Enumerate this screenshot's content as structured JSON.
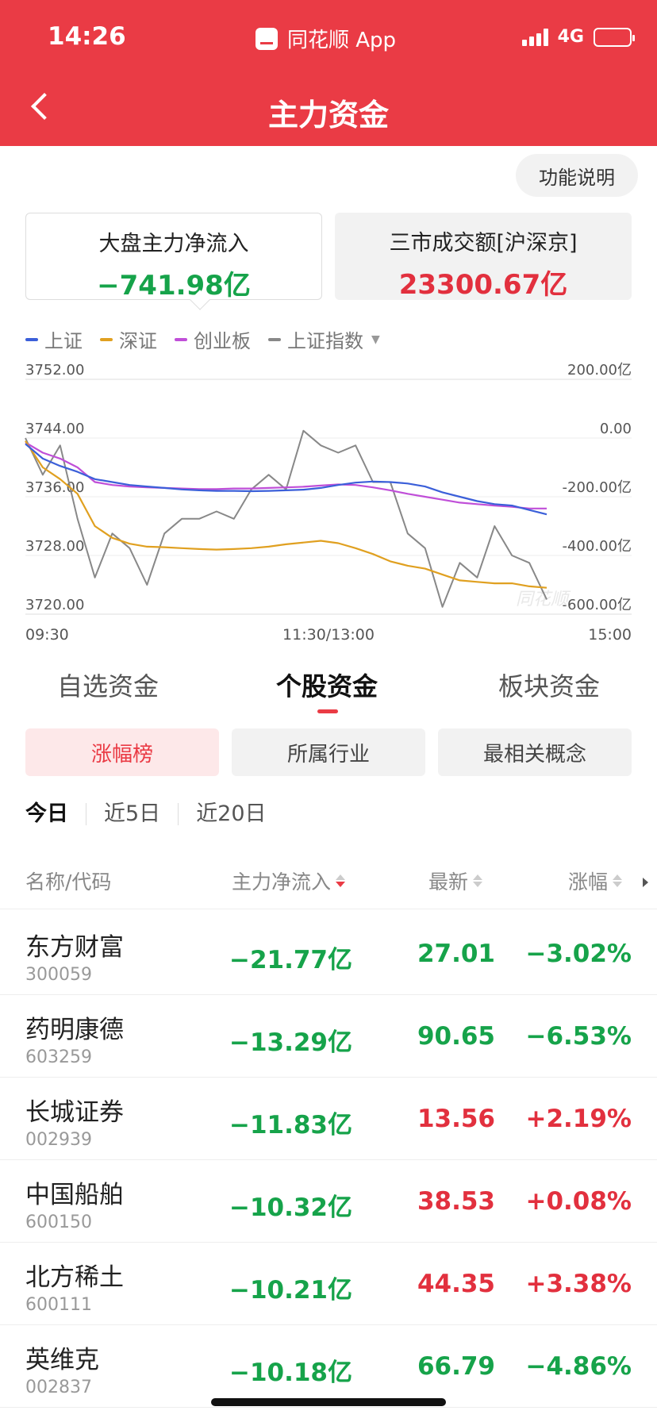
{
  "status": {
    "time": "14:26",
    "app_name": "同花顺 App",
    "network": "4G"
  },
  "header": {
    "title": "主力资金"
  },
  "func_button": "功能说明",
  "summary": {
    "left": {
      "title": "大盘主力净流入",
      "value": "−741.98亿"
    },
    "right": {
      "title": "三市成交额[沪深京]",
      "value": "23300.67亿"
    }
  },
  "legend": [
    {
      "label": "上证",
      "color": "#3b5fd9"
    },
    {
      "label": "深证",
      "color": "#e0a020"
    },
    {
      "label": "创业板",
      "color": "#c04fd8"
    },
    {
      "label": "上证指数",
      "color": "#888888"
    }
  ],
  "colors": {
    "accent": "#ea3b45",
    "up": "#e2303e",
    "down": "#16a34a"
  },
  "chart_data": {
    "type": "line",
    "x_ticks": [
      "09:30",
      "11:30/13:00",
      "15:00"
    ],
    "y_left_ticks": [
      "3752.00",
      "3744.00",
      "3736.00",
      "3728.00",
      "3720.00"
    ],
    "y_left_range": [
      3720,
      3752
    ],
    "y_right_ticks": [
      "200.00亿",
      "0.00",
      "-200.00亿",
      "-400.00亿",
      "-600.00亿"
    ],
    "y_right_range": [
      -600,
      200
    ],
    "watermark": "同花顺",
    "series": [
      {
        "name": "上证",
        "color": "#3b5fd9",
        "axis": "right",
        "values": [
          -20,
          -70,
          -95,
          -115,
          -140,
          -150,
          -160,
          -165,
          -170,
          -175,
          -178,
          -180,
          -180,
          -181,
          -180,
          -178,
          -176,
          -170,
          -160,
          -152,
          -148,
          -150,
          -155,
          -165,
          -185,
          -200,
          -215,
          -225,
          -230,
          -245,
          -260
        ]
      },
      {
        "name": "深证",
        "color": "#e0a020",
        "axis": "right",
        "values": [
          -10,
          -100,
          -140,
          -190,
          -300,
          -340,
          -360,
          -370,
          -372,
          -375,
          -378,
          -380,
          -378,
          -375,
          -370,
          -362,
          -356,
          -350,
          -358,
          -375,
          -395,
          -420,
          -435,
          -445,
          -465,
          -485,
          -490,
          -495,
          -495,
          -505,
          -510
        ]
      },
      {
        "name": "创业板",
        "color": "#c04fd8",
        "axis": "right",
        "values": [
          -15,
          -50,
          -70,
          -100,
          -150,
          -160,
          -165,
          -168,
          -170,
          -172,
          -174,
          -174,
          -172,
          -172,
          -170,
          -168,
          -166,
          -162,
          -158,
          -160,
          -168,
          -178,
          -190,
          -200,
          -210,
          -220,
          -225,
          -230,
          -234,
          -240,
          -240
        ]
      },
      {
        "name": "上证指数",
        "color": "#888888",
        "axis": "left",
        "values": [
          3744,
          3739,
          3743,
          3733,
          3725,
          3731,
          3729,
          3724,
          3731,
          3733,
          3733,
          3734,
          3733,
          3737,
          3739,
          3737,
          3745,
          3743,
          3742,
          3743,
          3738,
          3738,
          3731,
          3729,
          3721,
          3727,
          3725,
          3732,
          3728,
          3727,
          3722
        ]
      }
    ]
  },
  "tabs": [
    "自选资金",
    "个股资金",
    "板块资金"
  ],
  "sub_tabs": [
    "涨幅榜",
    "所属行业",
    "最相关概念"
  ],
  "periods": [
    "今日",
    "近5日",
    "近20日"
  ],
  "table": {
    "headers": [
      "名称/代码",
      "主力净流入",
      "最新",
      "涨幅"
    ],
    "rows": [
      {
        "name": "东方财富",
        "code": "300059",
        "flow": "−21.77亿",
        "price": "27.01",
        "change": "−3.02%",
        "dir": "down"
      },
      {
        "name": "药明康德",
        "code": "603259",
        "flow": "−13.29亿",
        "price": "90.65",
        "change": "−6.53%",
        "dir": "down"
      },
      {
        "name": "长城证券",
        "code": "002939",
        "flow": "−11.83亿",
        "price": "13.56",
        "change": "+2.19%",
        "dir": "up"
      },
      {
        "name": "中国船舶",
        "code": "600150",
        "flow": "−10.32亿",
        "price": "38.53",
        "change": "+0.08%",
        "dir": "up"
      },
      {
        "name": "北方稀土",
        "code": "600111",
        "flow": "−10.21亿",
        "price": "44.35",
        "change": "+3.38%",
        "dir": "up"
      },
      {
        "name": "英维克",
        "code": "002837",
        "flow": "−10.18亿",
        "price": "66.79",
        "change": "−4.86%",
        "dir": "down"
      }
    ]
  }
}
